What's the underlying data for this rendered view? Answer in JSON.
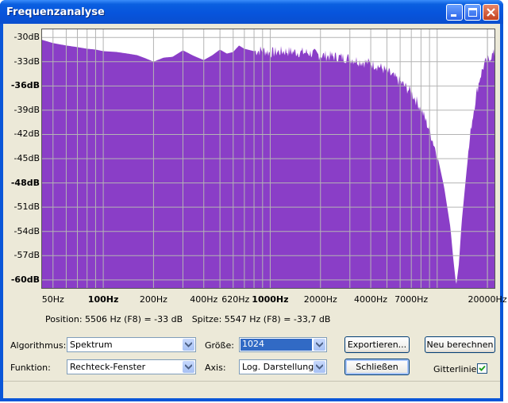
{
  "window": {
    "title": "Frequenzanalyse"
  },
  "title_buttons": [
    "minimize-button",
    "maximize-button",
    "close-button"
  ],
  "colors": {
    "spectrum_fill": "#8a3ec7",
    "grid": "#b4b4b4",
    "titlebar": "#0754dc"
  },
  "chart_data": {
    "type": "area",
    "x_scale": "log",
    "x_label": "",
    "y_label": "",
    "ylim": [
      -61,
      -29
    ],
    "xlim": [
      43,
      22050
    ],
    "y_ticks": [
      {
        "label": "-30dB",
        "value": -30,
        "bold": false
      },
      {
        "label": "-33dB",
        "value": -33,
        "bold": false
      },
      {
        "label": "-36dB",
        "value": -36,
        "bold": true
      },
      {
        "label": "-39dB",
        "value": -39,
        "bold": false
      },
      {
        "label": "-42dB",
        "value": -42,
        "bold": false
      },
      {
        "label": "-45dB",
        "value": -45,
        "bold": false
      },
      {
        "label": "-48dB",
        "value": -48,
        "bold": true
      },
      {
        "label": "-51dB",
        "value": -51,
        "bold": false
      },
      {
        "label": "-54dB",
        "value": -54,
        "bold": false
      },
      {
        "label": "-57dB",
        "value": -57,
        "bold": false
      },
      {
        "label": "-60dB",
        "value": -60,
        "bold": true
      }
    ],
    "x_ticks": [
      {
        "label": "50Hz",
        "value": 50,
        "bold": false
      },
      {
        "label": "100Hz",
        "value": 100,
        "bold": true
      },
      {
        "label": "200Hz",
        "value": 200,
        "bold": false
      },
      {
        "label": "400Hz",
        "value": 400,
        "bold": false
      },
      {
        "label": "620Hz",
        "value": 620,
        "bold": false
      },
      {
        "label": "1000Hz",
        "value": 1000,
        "bold": true
      },
      {
        "label": "2000Hz",
        "value": 2000,
        "bold": false
      },
      {
        "label": "4000Hz",
        "value": 4000,
        "bold": false
      },
      {
        "label": "7000Hz",
        "value": 7000,
        "bold": false
      },
      {
        "label": "20000Hz",
        "value": 20000,
        "bold": false
      }
    ],
    "spectrum": {
      "freqs": [
        43,
        50,
        60,
        70,
        80,
        90,
        100,
        120,
        140,
        160,
        180,
        200,
        230,
        260,
        300,
        350,
        400,
        450,
        500,
        550,
        600,
        650,
        700,
        800,
        900,
        1000,
        1200,
        1400,
        1700,
        2000,
        2500,
        3000,
        3500,
        4000,
        4500,
        5000,
        5500,
        6000,
        7000,
        8000,
        9000,
        10000,
        11000,
        12000,
        12500,
        13000,
        13500,
        14000,
        15000,
        16000,
        17000,
        18000,
        19000,
        20000,
        21000,
        22050
      ],
      "db": [
        -30.3,
        -30.7,
        -31.0,
        -31.2,
        -31.4,
        -31.5,
        -31.7,
        -31.8,
        -32.0,
        -32.2,
        -32.6,
        -33.0,
        -32.5,
        -32.4,
        -31.6,
        -32.3,
        -32.8,
        -32.2,
        -31.5,
        -32.0,
        -31.8,
        -31.0,
        -31.4,
        -31.7,
        -31.6,
        -31.9,
        -31.7,
        -31.8,
        -31.9,
        -32.2,
        -32.4,
        -32.6,
        -33.0,
        -33.2,
        -33.6,
        -34.2,
        -34.9,
        -35.5,
        -36.8,
        -38.8,
        -41.5,
        -44.5,
        -48.5,
        -53.5,
        -57.5,
        -60.7,
        -58.0,
        -53.0,
        -46.5,
        -41.0,
        -37.5,
        -35.0,
        -33.5,
        -32.8,
        -32.3,
        -32.0
      ]
    }
  },
  "status": {
    "position": "Position: 5506 Hz (F8) = -33 dB",
    "peak": "Spitze: 5547 Hz (F8) = -33,7 dB"
  },
  "controls": {
    "algorithm_label": "Algorithmus:",
    "algorithm_value": "Spektrum",
    "size_label": "Größe:",
    "size_value": "1024",
    "function_label": "Funktion:",
    "function_value": "Rechteck-Fenster",
    "axis_label": "Axis:",
    "axis_value": "Log. Darstellung",
    "export_button": "Exportieren...",
    "recalc_button": "Neu berechnen",
    "close_button": "Schließen",
    "gridlines_label": "Gitterlinien",
    "gridlines_checked": true
  }
}
